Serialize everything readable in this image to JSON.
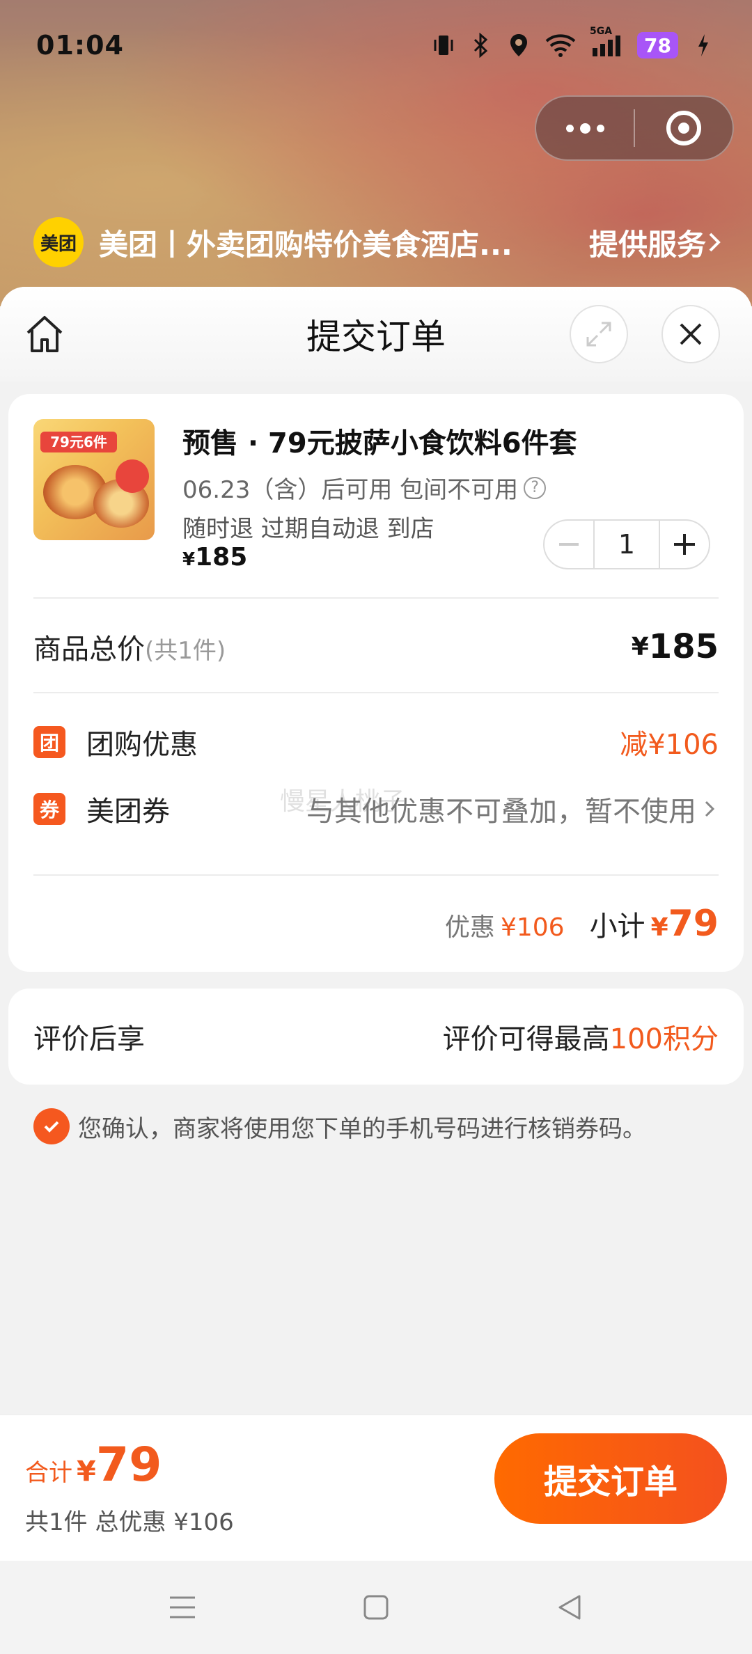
{
  "status_bar": {
    "time": "01:04",
    "battery": "78",
    "signal_label": "5GA"
  },
  "mini_program": {
    "brand_logo_text": "美团",
    "brand_name": "美团丨外卖团购特价美食酒店...",
    "service_label": "提供服务"
  },
  "sheet": {
    "title": "提交订单"
  },
  "product": {
    "thumb_text": "79元6件",
    "title": "预售 · 79元披萨小食饮料6件套",
    "meta": "06.23（含）后可用 包间不可用",
    "refund": "随时退 过期自动退 到店",
    "price_symbol": "¥",
    "price": "185",
    "quantity": "1"
  },
  "summary": {
    "total_label": "商品总价",
    "total_count": "(共1件)",
    "total_symbol": "¥",
    "total_value": "185",
    "group_badge": "团",
    "group_label": "团购优惠",
    "group_value": "减¥106",
    "coupon_badge": "券",
    "coupon_label": "美团券",
    "coupon_note": "与其他优惠不可叠加，暂不使用",
    "watermark": "慢星人桃子",
    "discount_label": "优惠",
    "discount_value": "¥106",
    "subtotal_label": "小计",
    "subtotal_symbol": "¥",
    "subtotal_value": "79"
  },
  "review": {
    "label": "评价后享",
    "desc_prefix": "评价可得最高",
    "desc_highlight": "100积分"
  },
  "confirm": {
    "text": "您确认，商家将使用您下单的手机号码进行核销券码。",
    "checked": true
  },
  "bottom_bar": {
    "sum_label": "合计",
    "sum_symbol": "¥",
    "sum_value": "79",
    "detail": "共1件 总优惠 ¥106",
    "submit_label": "提交订单"
  },
  "colors": {
    "accent": "#f25a1d",
    "button_gradient_start": "#ff6a00",
    "button_gradient_end": "#f4511e",
    "brand_yellow": "#ffd100",
    "battery": "#a855f7"
  },
  "icons": [
    "vibrate-icon",
    "bluetooth-icon",
    "location-icon",
    "wifi-icon",
    "signal-icon",
    "charging-icon",
    "more-icon",
    "target-icon",
    "chevron-right-icon",
    "home-icon",
    "expand-icon",
    "close-icon",
    "question-icon",
    "minus-icon",
    "plus-icon",
    "check-icon",
    "menu-icon",
    "square-icon",
    "back-icon"
  ]
}
